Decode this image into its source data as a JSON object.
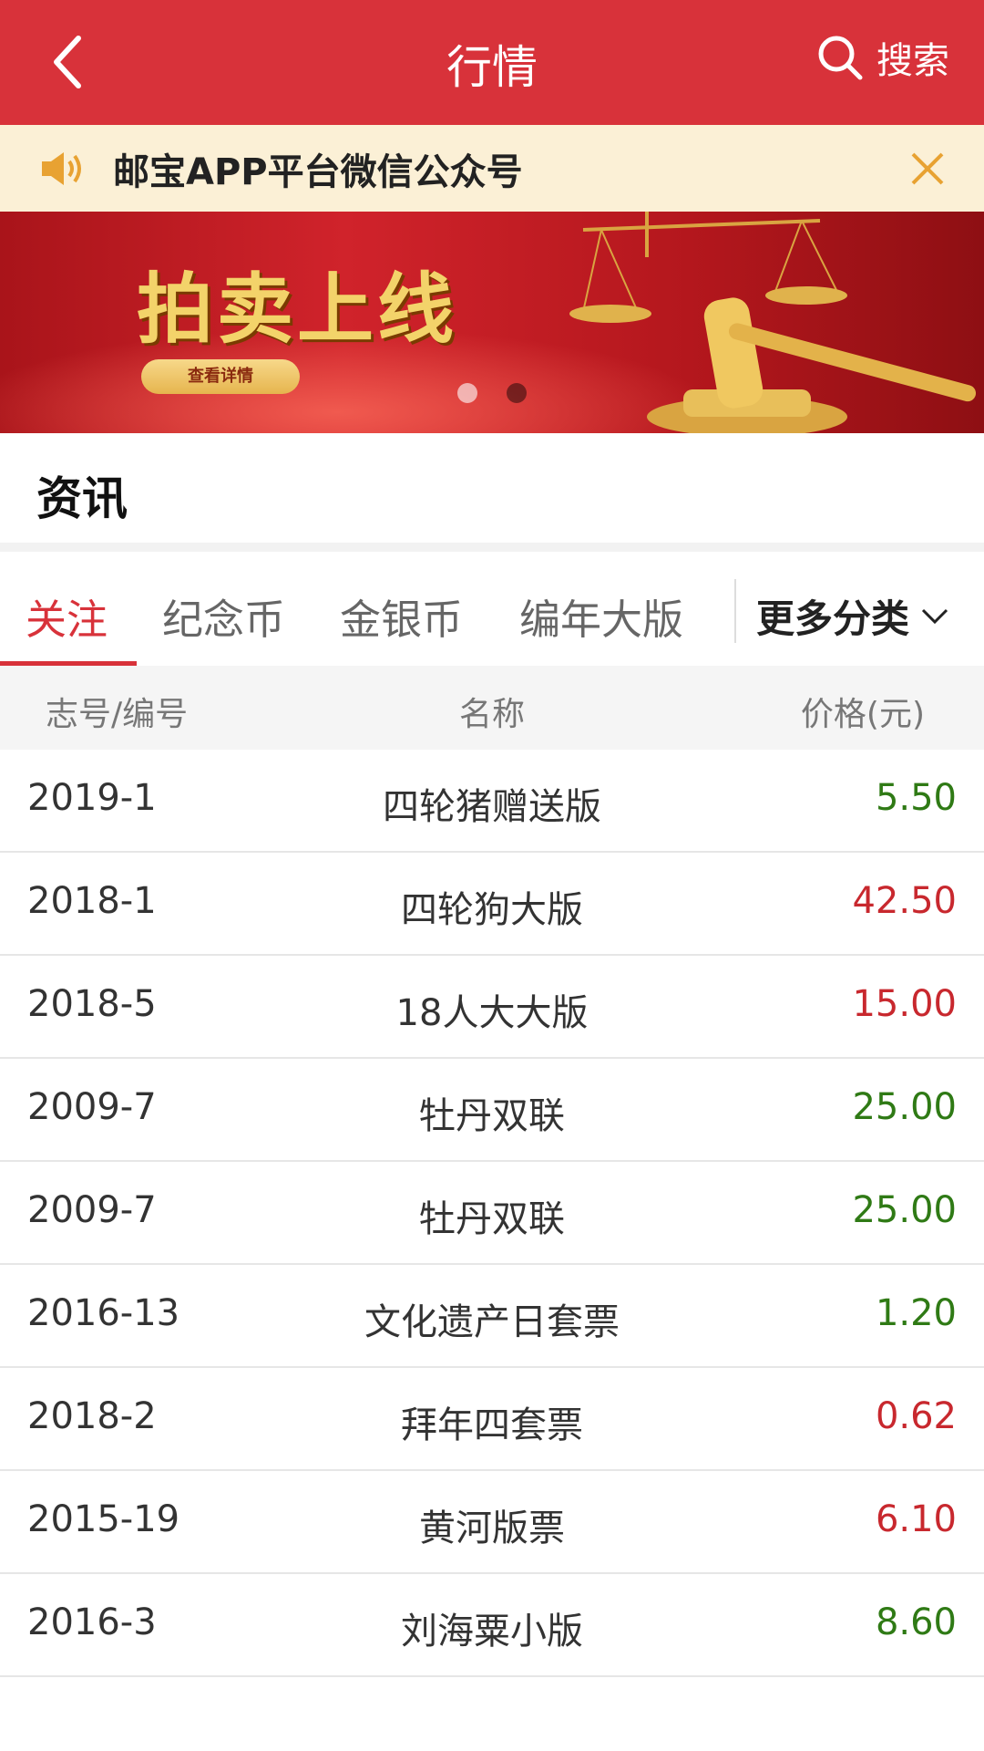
{
  "header": {
    "title": "行情",
    "search_label": "搜索"
  },
  "notice": {
    "text": "邮宝APP平台微信公众号"
  },
  "banner": {
    "headline": "拍卖上线",
    "button": "查看详情"
  },
  "section": {
    "title": "资讯"
  },
  "tabs": {
    "items": [
      "关注",
      "纪念币",
      "金银币",
      "编年大版"
    ],
    "more": "更多分类"
  },
  "table": {
    "headers": [
      "志号/编号",
      "名称",
      "价格(元)"
    ],
    "rows": [
      {
        "code": "2019-1",
        "name": "四轮猪赠送版",
        "price": "5.50",
        "trend": "down"
      },
      {
        "code": "2018-1",
        "name": "四轮狗大版",
        "price": "42.50",
        "trend": "up"
      },
      {
        "code": "2018-5",
        "name": "18人大大版",
        "price": "15.00",
        "trend": "up"
      },
      {
        "code": "2009-7",
        "name": "牡丹双联",
        "price": "25.00",
        "trend": "down"
      },
      {
        "code": "2009-7",
        "name": "牡丹双联",
        "price": "25.00",
        "trend": "down"
      },
      {
        "code": "2016-13",
        "name": "文化遗产日套票",
        "price": "1.20",
        "trend": "down"
      },
      {
        "code": "2018-2",
        "name": "拜年四套票",
        "price": "0.62",
        "trend": "up"
      },
      {
        "code": "2015-19",
        "name": "黄河版票",
        "price": "6.10",
        "trend": "up"
      },
      {
        "code": "2016-3",
        "name": "刘海粟小版",
        "price": "8.60",
        "trend": "down"
      }
    ]
  },
  "colors": {
    "brand": "#d8323a",
    "up": "#c8282e",
    "down": "#2f7a15"
  }
}
